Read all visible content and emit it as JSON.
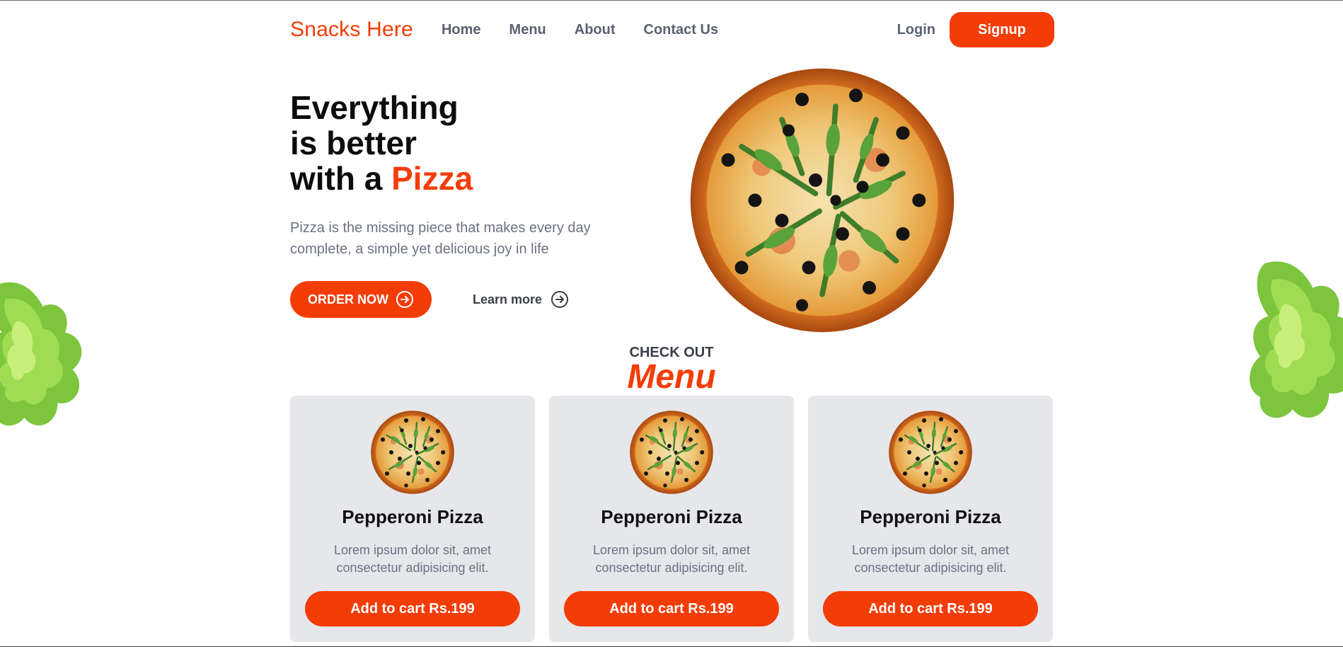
{
  "brand": {
    "name": "Snacks Here",
    "accent_color": "#f43c06"
  },
  "nav": {
    "links": [
      "Home",
      "Menu",
      "About",
      "Contact Us"
    ],
    "login_label": "Login",
    "signup_label": "Signup"
  },
  "hero": {
    "title_line1": "Everything",
    "title_line2": "is better",
    "title_line3_prefix": "with a ",
    "title_line3_accent": "Pizza",
    "description": "Pizza is the missing piece that makes every day complete, a simple yet delicious joy in life",
    "order_label": "ORDER NOW",
    "learn_label": "Learn more"
  },
  "menu_section": {
    "kicker": "CHECK OUT",
    "title": "Menu",
    "cards": [
      {
        "name": "Pepperoni Pizza",
        "description": "Lorem ipsum dolor sit, amet consectetur adipisicing elit.",
        "button": "Add to cart Rs.199"
      },
      {
        "name": "Pepperoni Pizza",
        "description": "Lorem ipsum dolor sit, amet consectetur adipisicing elit.",
        "button": "Add to cart Rs.199"
      },
      {
        "name": "Pepperoni Pizza",
        "description": "Lorem ipsum dolor sit, amet consectetur adipisicing elit.",
        "button": "Add to cart Rs.199"
      }
    ]
  },
  "icons": {
    "order_arrow": "circle-arrow-right-icon",
    "learn_arrow": "circle-arrow-right-icon"
  }
}
